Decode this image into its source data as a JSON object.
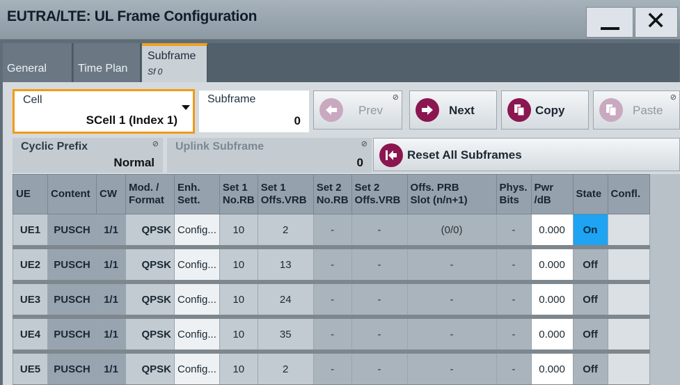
{
  "window": {
    "title": "EUTRA/LTE: UL Frame Configuration"
  },
  "tabs": [
    {
      "label": "General"
    },
    {
      "label": "Time Plan"
    },
    {
      "label": "Subframe",
      "sublabel": "Sf 0"
    }
  ],
  "cell": {
    "label": "Cell",
    "value": "SCell 1 (Index 1)"
  },
  "subframe": {
    "label": "Subframe",
    "value": "0"
  },
  "buttons": {
    "prev": "Prev",
    "next": "Next",
    "copy": "Copy",
    "paste": "Paste",
    "reset": "Reset All Subframes"
  },
  "cyclic_prefix": {
    "label": "Cyclic Prefix",
    "value": "Normal"
  },
  "uplink_subframe": {
    "label": "Uplink Subframe",
    "value": "0"
  },
  "table": {
    "headers": [
      [
        "UE"
      ],
      [
        "Content"
      ],
      [
        "CW"
      ],
      [
        "Mod. /",
        "Format"
      ],
      [
        "Enh.",
        "Sett."
      ],
      [
        "Set 1",
        "No.RB"
      ],
      [
        "Set 1",
        "Offs.VRB"
      ],
      [
        "Set 2",
        "No.RB"
      ],
      [
        "Set 2",
        "Offs.VRB"
      ],
      [
        "Offs. PRB",
        "Slot (n/n+1)"
      ],
      [
        "Phys.",
        "Bits"
      ],
      [
        "Pwr",
        "/dB"
      ],
      [
        "State"
      ],
      [
        "Confl."
      ]
    ],
    "rows": [
      [
        "UE1",
        "PUSCH",
        "1/1",
        "QPSK",
        "Config...",
        "10",
        "2",
        "-",
        "-",
        "(0/0)",
        "-",
        "0.000",
        "On",
        ""
      ],
      [
        "UE2",
        "PUSCH",
        "1/1",
        "QPSK",
        "Config...",
        "10",
        "13",
        "-",
        "-",
        "-",
        "-",
        "0.000",
        "Off",
        ""
      ],
      [
        "UE3",
        "PUSCH",
        "1/1",
        "QPSK",
        "Config...",
        "10",
        "24",
        "-",
        "-",
        "-",
        "-",
        "0.000",
        "Off",
        ""
      ],
      [
        "UE4",
        "PUSCH",
        "1/1",
        "QPSK",
        "Config...",
        "10",
        "35",
        "-",
        "-",
        "-",
        "-",
        "0.000",
        "Off",
        ""
      ],
      [
        "UE5",
        "PUSCH",
        "1/1",
        "QPSK",
        "Config...",
        "10",
        "2",
        "-",
        "-",
        "-",
        "-",
        "0.000",
        "Off",
        ""
      ]
    ]
  },
  "colors": {
    "accent_orange": "#f29a15",
    "state_on": "#1ea4f2",
    "button_icon": "#8b1650"
  }
}
